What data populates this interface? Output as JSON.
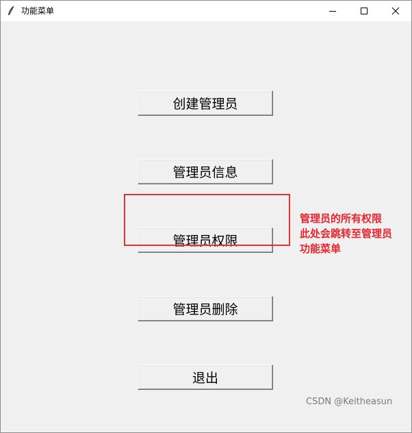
{
  "window": {
    "title": "功能菜单",
    "icon": "feather-icon",
    "controls": {
      "minimize": "minimize-icon",
      "maximize": "maximize-icon",
      "close": "close-icon"
    }
  },
  "menu": {
    "buttons": [
      {
        "label": "创建管理员"
      },
      {
        "label": "管理员信息"
      },
      {
        "label": "管理员权限"
      },
      {
        "label": "管理员删除"
      },
      {
        "label": "退出"
      }
    ]
  },
  "annotation": {
    "lines": [
      "管理员的所有权限",
      "此处会跳转至管理员",
      "功能菜单"
    ],
    "color": "#e8242c",
    "box_color": "#e53333"
  },
  "watermark": {
    "text": "CSDN @Keitheasun"
  }
}
